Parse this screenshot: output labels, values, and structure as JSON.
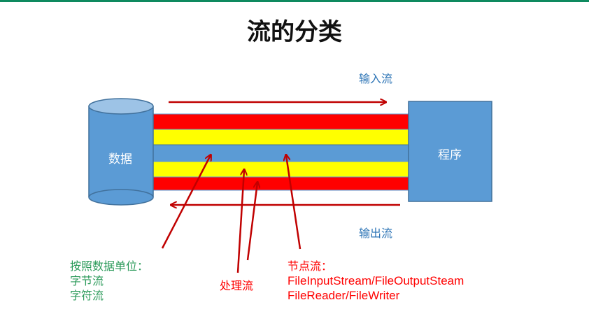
{
  "title": "流的分类",
  "colors": {
    "accent_rule": "#0e8a5f",
    "band_red": "#ff0000",
    "band_yellow": "#ffff00",
    "band_blue": "#5b9bd5",
    "arrow": "#c00000",
    "box": "#5b9bd5"
  },
  "data_cylinder": {
    "label": "数据"
  },
  "program_box": {
    "label": "程序"
  },
  "input_stream": {
    "label": "输入流"
  },
  "output_stream": {
    "label": "输出流"
  },
  "by_unit": {
    "line1": "按照数据单位：",
    "line2": "字节流",
    "line3": "字符流"
  },
  "processing_stream": {
    "label": "处理流"
  },
  "node_stream": {
    "line1": "节点流：",
    "line2": "FileInputStream/FileOutputSteam",
    "line3": "FileReader/FileWriter"
  }
}
